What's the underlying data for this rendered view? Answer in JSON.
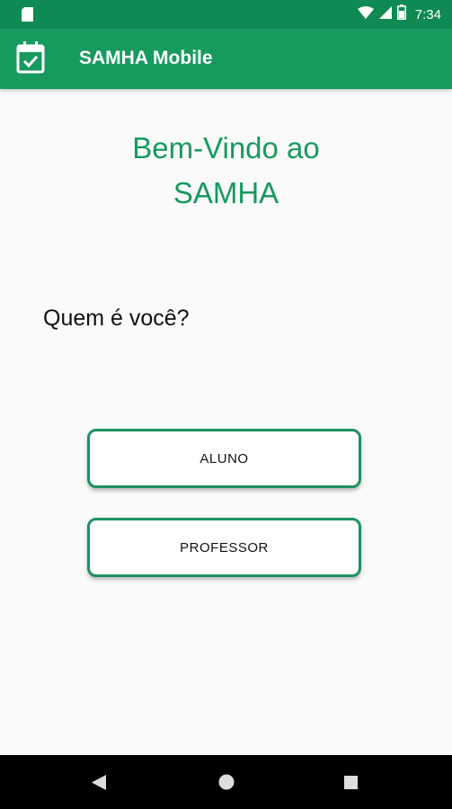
{
  "status_bar": {
    "time": "7:34",
    "icons": [
      "sd-card-icon",
      "wifi-icon",
      "signal-icon",
      "battery-icon"
    ]
  },
  "app_bar": {
    "title": "SAMHA Mobile",
    "icon": "calendar-check-icon"
  },
  "main": {
    "welcome_line1": "Bem-Vindo ao",
    "welcome_line2": "SAMHA",
    "question": "Quem é você?",
    "buttons": {
      "aluno": "ALUNO",
      "professor": "PROFESSOR"
    }
  },
  "nav_bar": {
    "icons": [
      "back-icon",
      "home-icon",
      "recents-icon"
    ]
  },
  "colors": {
    "primary": "#179a5e",
    "primary_dark": "#0f8a52",
    "button_border": "#1e9160"
  }
}
